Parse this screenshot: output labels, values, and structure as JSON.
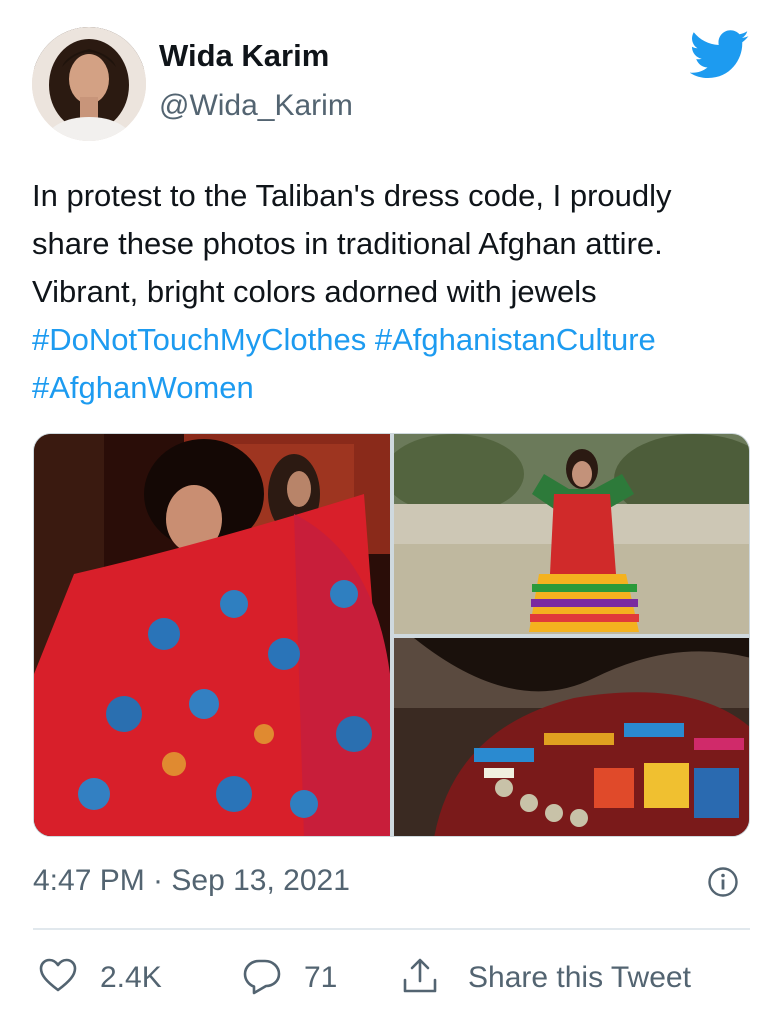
{
  "author": {
    "name": "Wida Karim",
    "handle": "@Wida_Karim"
  },
  "tweet": {
    "lines": [
      "In protest to the Taliban's dress code, I proudly",
      "share these photos in traditional Afghan attire.",
      "Vibrant, bright colors adorned with jewels"
    ],
    "hashtags_line1": [
      "#DoNotTouchMyClothes",
      "#AfghanistanCulture"
    ],
    "hashtags_line2": [
      "#AfghanWomen"
    ]
  },
  "timestamp": "4:47 PM · Sep 13, 2021",
  "actions": {
    "likes": "2.4K",
    "replies": "71",
    "share_label": "Share this Tweet"
  },
  "icons": {
    "brand": "twitter-bird-icon",
    "info": "info-icon",
    "like": "heart-icon",
    "reply": "reply-bubble-icon",
    "share": "share-icon"
  },
  "colors": {
    "accent": "#1d9bf0",
    "text": "#0f1419",
    "muted": "#536471",
    "divider": "#e1e8ed"
  }
}
